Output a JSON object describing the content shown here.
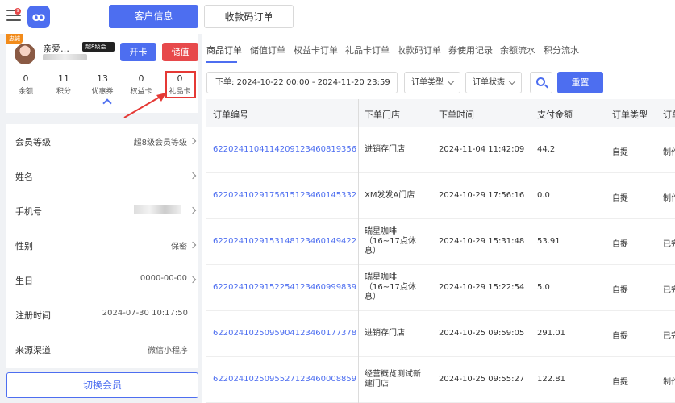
{
  "header": {
    "notification_count": "9",
    "logo_glyph": "ꝏ",
    "tabs": [
      {
        "label": "客户信息",
        "active": true
      },
      {
        "label": "收款码订单",
        "active": false
      }
    ]
  },
  "member": {
    "vip_tag": "忠诚",
    "name": "亲爱…",
    "level_badge": "超8级会…",
    "open_card_label": "开卡",
    "deposit_label": "储值",
    "stats": [
      {
        "value": "0",
        "label": "余额"
      },
      {
        "value": "11",
        "label": "积分"
      },
      {
        "value": "13",
        "label": "优惠券"
      },
      {
        "value": "0",
        "label": "权益卡"
      },
      {
        "value": "0",
        "label": "礼品卡"
      }
    ]
  },
  "info": {
    "rows": [
      {
        "label": "会员等级",
        "value": "超8级会员等级",
        "chevron": true
      },
      {
        "label": "姓名",
        "value": "",
        "chevron": true
      },
      {
        "label": "手机号",
        "value": "",
        "chevron": true,
        "blurred": true
      },
      {
        "label": "性别",
        "value": "保密",
        "chevron": true
      },
      {
        "label": "生日",
        "value": "0000-00-00",
        "chevron": true
      },
      {
        "label": "注册时间",
        "value": "2024-07-30 10:17:50",
        "chevron": false
      },
      {
        "label": "来源渠道",
        "value": "微信小程序",
        "chevron": false
      }
    ],
    "switch_label": "切换会员"
  },
  "orders": {
    "sub_tabs": [
      "商品订单",
      "储值订单",
      "权益卡订单",
      "礼品卡订单",
      "收款码订单",
      "券使用记录",
      "余额流水",
      "积分流水"
    ],
    "filters": {
      "date_label": "下单:",
      "date_range": "2024-10-22 00:00 - 2024-11-20 23:59",
      "order_type": "订单类型",
      "order_status": "订单状态",
      "reset_label": "重置"
    },
    "columns": [
      "订单编号",
      "下单门店",
      "下单时间",
      "支付金额",
      "订单类型",
      "订单"
    ],
    "rows": [
      {
        "id": "6220241104114209123460819356",
        "store": "进销存门店",
        "time": "2024-11-04 11:42:09",
        "amount": "44.2",
        "type": "自提",
        "status": "制作"
      },
      {
        "id": "6220241029175615123460145332",
        "store": "XM发发A门店",
        "time": "2024-10-29 17:56:16",
        "amount": "0.0",
        "type": "自提",
        "status": "制作"
      },
      {
        "id": "6220241029153148123460149422",
        "store": "瑞星咖啡（16~17点休息）",
        "time": "2024-10-29 15:31:48",
        "amount": "53.91",
        "type": "自提",
        "status": "已完"
      },
      {
        "id": "6220241029152254123460999839",
        "store": "瑞星咖啡（16~17点休息）",
        "time": "2024-10-29 15:22:54",
        "amount": "5.0",
        "type": "自提",
        "status": "已完"
      },
      {
        "id": "6220241025095904123460177378",
        "store": "进销存门店",
        "time": "2024-10-25 09:59:05",
        "amount": "291.01",
        "type": "自提",
        "status": "已完"
      },
      {
        "id": "6220241025095527123460008859",
        "store": "经营概览测试新建门店",
        "time": "2024-10-25 09:55:27",
        "amount": "122.81",
        "type": "自提",
        "status": "制作"
      }
    ]
  },
  "colors": {
    "primary": "#4d6ef0",
    "danger": "#e7494b",
    "highlight": "#e53935",
    "vip": "#f28b1a"
  }
}
